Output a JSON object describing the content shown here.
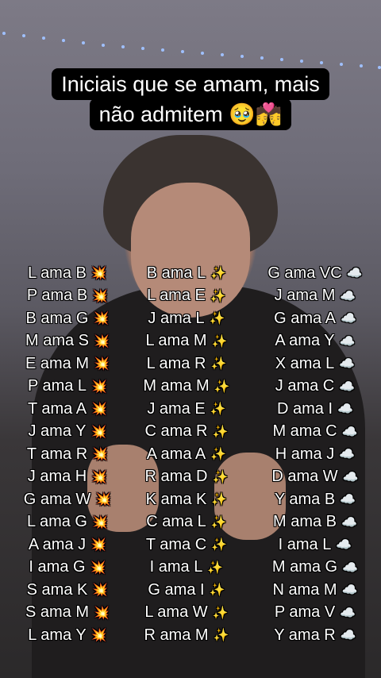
{
  "caption": {
    "line1": "Iniciais que se amam, mais",
    "line2": "não admitem 🥹💏"
  },
  "icons": {
    "col1": "💥",
    "col2": "✨",
    "col3": "☁️"
  },
  "columns": [
    [
      "L ama B",
      "P ama B",
      "B ama G",
      "M ama S",
      "E ama M",
      "P ama L",
      "T ama A",
      "J ama Y",
      "T ama R",
      "J ama H",
      "G ama W",
      "L ama G",
      "A ama J",
      "I ama G",
      "S ama K",
      "S ama M",
      "L ama Y"
    ],
    [
      "B ama L",
      "L ama E",
      "J ama L",
      "L ama M",
      "L ama R",
      "M ama M",
      "J ama E",
      "C ama R",
      "A ama A",
      "R ama D",
      "K ama K",
      "C ama L",
      "T ama C",
      "I ama L",
      "G ama I",
      "L ama W",
      "R ama M"
    ],
    [
      "G ama VC",
      "J ama M",
      "G ama A",
      "A ama Y",
      "X ama L",
      "J ama C",
      "D ama I",
      "M ama C",
      "H ama J",
      "D ama W",
      "Y ama B",
      "M ama B",
      "I ama L",
      "M ama G",
      "N ama M",
      "P ama V",
      "Y ama R"
    ]
  ]
}
